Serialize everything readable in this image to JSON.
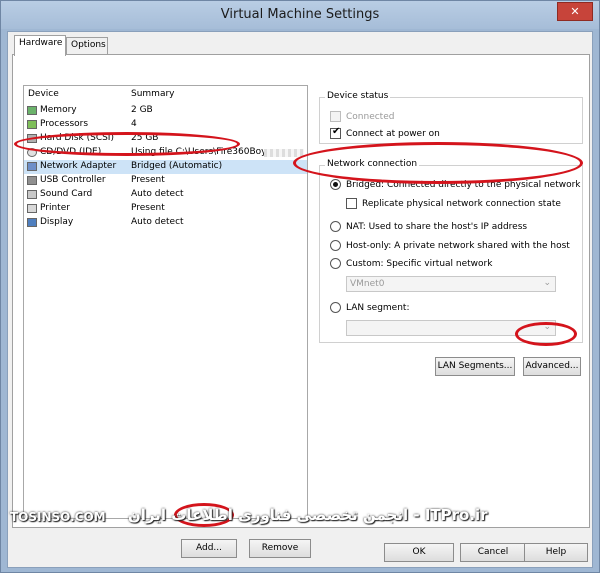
{
  "window": {
    "title": "Virtual Machine Settings",
    "close_glyph": "✕"
  },
  "tabs": [
    {
      "label": "Hardware"
    },
    {
      "label": "Options"
    }
  ],
  "device_list": {
    "headers": {
      "device": "Device",
      "summary": "Summary"
    },
    "rows": [
      {
        "icon": "memory-icon",
        "name": "Memory",
        "summary": "2 GB"
      },
      {
        "icon": "processor-icon",
        "name": "Processors",
        "summary": "4"
      },
      {
        "icon": "hard-disk-icon",
        "name": "Hard Disk (SCSI)",
        "summary": "25 GB"
      },
      {
        "icon": "cd-dvd-icon",
        "name": "CD/DVD (IDE)",
        "summary": "Using file C:\\Users\\Fire360Boy"
      },
      {
        "icon": "network-adapter-icon",
        "name": "Network Adapter",
        "summary": "Bridged (Automatic)"
      },
      {
        "icon": "usb-icon",
        "name": "USB Controller",
        "summary": "Present"
      },
      {
        "icon": "sound-card-icon",
        "name": "Sound Card",
        "summary": "Auto detect"
      },
      {
        "icon": "printer-icon",
        "name": "Printer",
        "summary": "Present"
      },
      {
        "icon": "display-icon",
        "name": "Display",
        "summary": "Auto detect"
      }
    ],
    "selected_index": 4
  },
  "device_status": {
    "title": "Device status",
    "connected": {
      "label": "Connected",
      "checked": false,
      "disabled": true
    },
    "connect_at_power_on": {
      "label": "Connect at power on",
      "checked": true
    }
  },
  "network_connection": {
    "title": "Network connection",
    "bridged": {
      "label": "Bridged: Connected directly to the physical network",
      "selected": true
    },
    "replicate": {
      "label": "Replicate physical network connection state",
      "checked": false
    },
    "nat": {
      "label": "NAT: Used to share the host's IP address"
    },
    "host_only": {
      "label": "Host-only: A private network shared with the host"
    },
    "custom": {
      "label": "Custom: Specific virtual network"
    },
    "custom_select": {
      "value": "VMnet0"
    },
    "lan_segment": {
      "label": "LAN segment:"
    },
    "lan_select": {
      "value": ""
    }
  },
  "buttons": {
    "lan_segments": "LAN Segments...",
    "advanced": "Advanced...",
    "add": "Add...",
    "remove": "Remove",
    "ok": "OK",
    "cancel": "Cancel",
    "help": "Help"
  },
  "watermark": {
    "left": "TOSINSO.COM",
    "right": "انجمن تخصصی فناوری اطلاعات ایران - ITPro.ir"
  },
  "colors": {
    "annotation": "#d4141c",
    "selection": "#cde3f7"
  }
}
